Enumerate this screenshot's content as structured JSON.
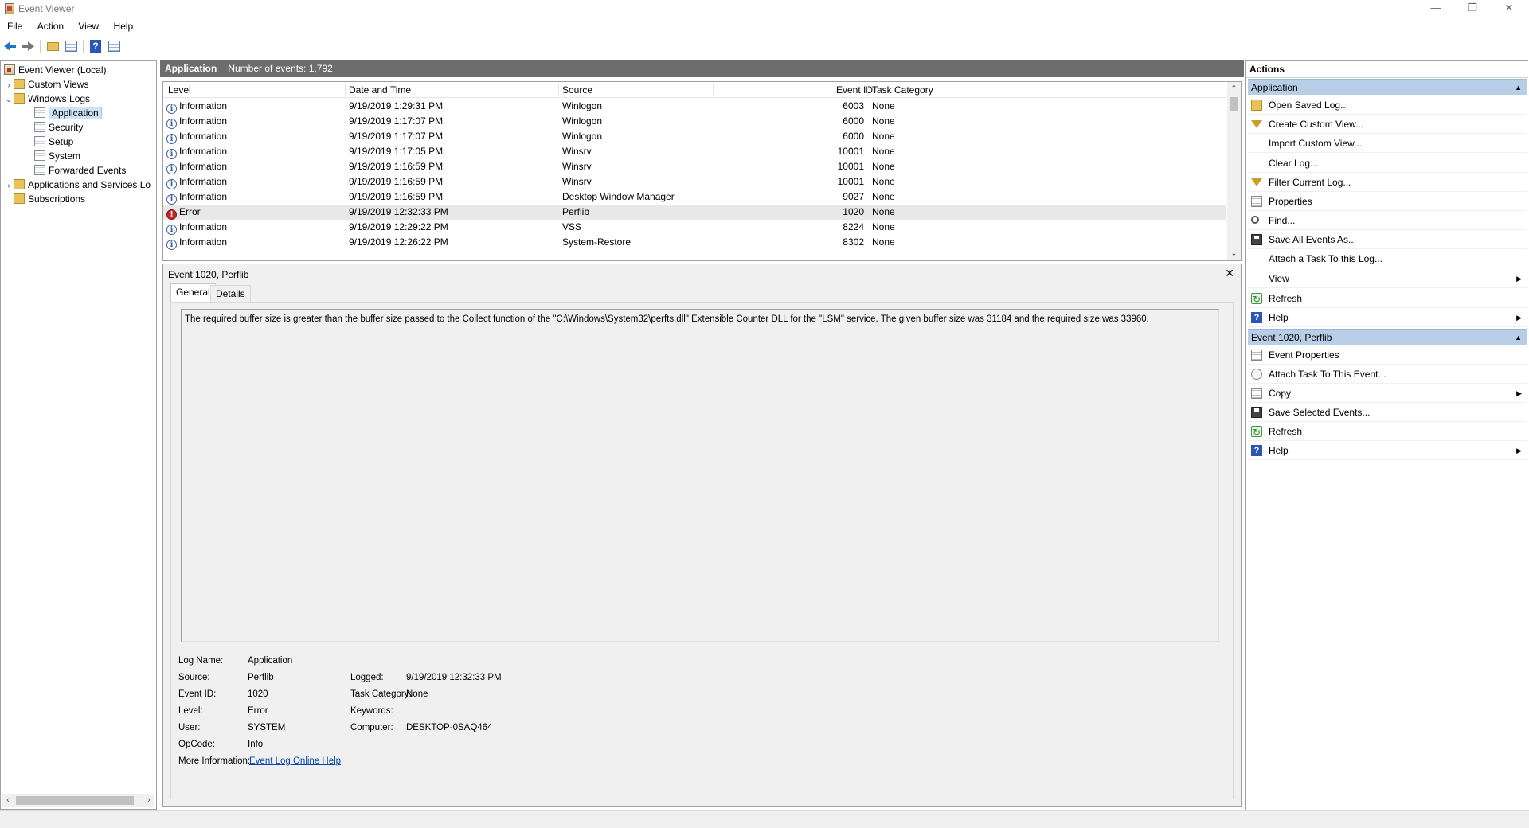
{
  "window": {
    "title": "Event Viewer",
    "minimize": "—",
    "restore": "❐",
    "close": "✕"
  },
  "menu": [
    "File",
    "Action",
    "View",
    "Help"
  ],
  "tree": {
    "root": "Event Viewer (Local)",
    "custom_views": "Custom Views",
    "windows_logs": "Windows Logs",
    "logs": [
      "Application",
      "Security",
      "Setup",
      "System",
      "Forwarded Events"
    ],
    "apps_services": "Applications and Services Lo",
    "subscriptions": "Subscriptions"
  },
  "log_header": {
    "name": "Application",
    "count": "Number of events: 1,792"
  },
  "columns": [
    "Level",
    "Date and Time",
    "Source",
    "Event ID",
    "Task Category"
  ],
  "events": [
    {
      "level": "Information",
      "date": "9/19/2019 1:29:31 PM",
      "source": "Winlogon",
      "id": "6003",
      "category": "None"
    },
    {
      "level": "Information",
      "date": "9/19/2019 1:17:07 PM",
      "source": "Winlogon",
      "id": "6000",
      "category": "None"
    },
    {
      "level": "Information",
      "date": "9/19/2019 1:17:07 PM",
      "source": "Winlogon",
      "id": "6000",
      "category": "None"
    },
    {
      "level": "Information",
      "date": "9/19/2019 1:17:05 PM",
      "source": "Winsrv",
      "id": "10001",
      "category": "None"
    },
    {
      "level": "Information",
      "date": "9/19/2019 1:16:59 PM",
      "source": "Winsrv",
      "id": "10001",
      "category": "None"
    },
    {
      "level": "Information",
      "date": "9/19/2019 1:16:59 PM",
      "source": "Winsrv",
      "id": "10001",
      "category": "None"
    },
    {
      "level": "Information",
      "date": "9/19/2019 1:16:59 PM",
      "source": "Desktop Window Manager",
      "id": "9027",
      "category": "None"
    },
    {
      "level": "Error",
      "date": "9/19/2019 12:32:33 PM",
      "source": "Perflib",
      "id": "1020",
      "category": "None"
    },
    {
      "level": "Information",
      "date": "9/19/2019 12:29:22 PM",
      "source": "VSS",
      "id": "8224",
      "category": "None"
    },
    {
      "level": "Information",
      "date": "9/19/2019 12:26:22 PM",
      "source": "System-Restore",
      "id": "8302",
      "category": "None"
    }
  ],
  "detail": {
    "title": "Event 1020, Perflib",
    "tabs": [
      "General",
      "Details"
    ],
    "message": "The required buffer size is greater than the buffer size passed to the Collect function of the \"C:\\Windows\\System32\\perfts.dll\" Extensible Counter DLL for the \"LSM\" service. The given buffer size was 31184 and the required size was 33960.",
    "fields": {
      "log_name_label": "Log Name:",
      "log_name": "Application",
      "source_label": "Source:",
      "source": "Perflib",
      "event_id_label": "Event ID:",
      "event_id": "1020",
      "level_label": "Level:",
      "level": "Error",
      "user_label": "User:",
      "user": "SYSTEM",
      "opcode_label": "OpCode:",
      "opcode": "Info",
      "more_info_label": "More Information:",
      "more_info_link": "Event Log Online Help",
      "logged_label": "Logged:",
      "logged": "9/19/2019 12:32:33 PM",
      "task_category_label": "Task Category:",
      "task_category": "None",
      "keywords_label": "Keywords:",
      "keywords": "",
      "computer_label": "Computer:",
      "computer": "DESKTOP-0SAQ464"
    }
  },
  "actions": {
    "title": "Actions",
    "group1": "Application",
    "group1_items": [
      "Open Saved Log...",
      "Create Custom View...",
      "Import Custom View...",
      "Clear Log...",
      "Filter Current Log...",
      "Properties",
      "Find...",
      "Save All Events As...",
      "Attach a Task To this Log...",
      "View",
      "Refresh",
      "Help"
    ],
    "group2": "Event 1020, Perflib",
    "group2_items": [
      "Event Properties",
      "Attach Task To This Event...",
      "Copy",
      "Save Selected Events...",
      "Refresh",
      "Help"
    ]
  }
}
